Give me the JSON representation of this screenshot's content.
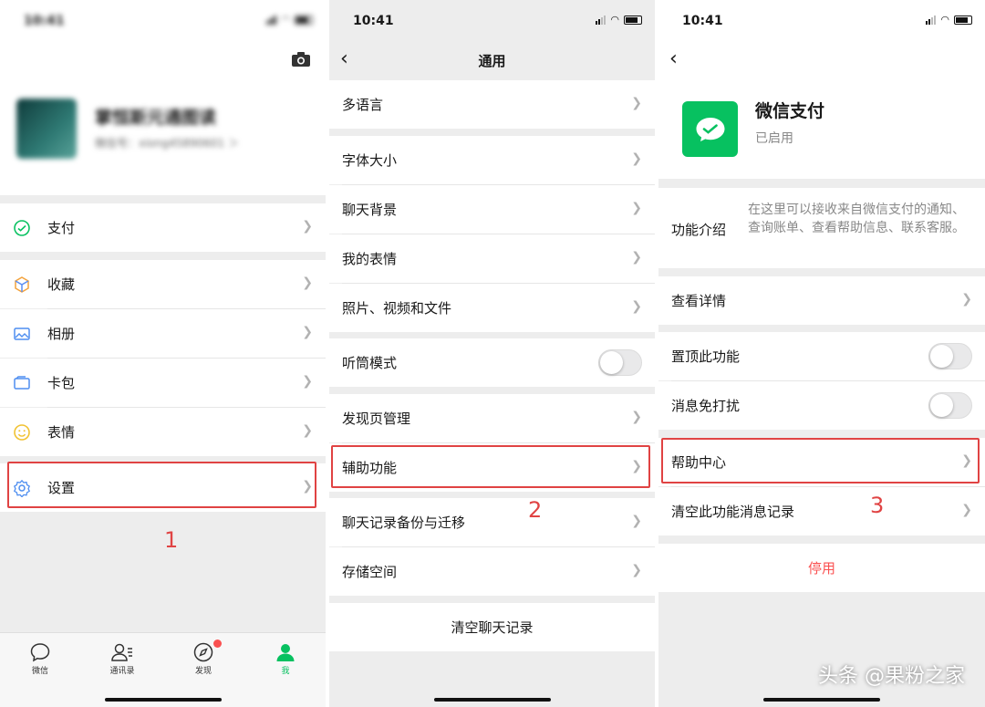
{
  "panel1": {
    "status": {
      "time": "10:41"
    },
    "profile": {
      "name": "掌恒斯元通图读",
      "id_line": "微信号：xiong45890601 ＞"
    },
    "items": [
      {
        "label": "支付",
        "icon": "wallet-icon"
      },
      {
        "label": "收藏",
        "icon": "cube-icon"
      },
      {
        "label": "相册",
        "icon": "photo-icon"
      },
      {
        "label": "卡包",
        "icon": "card-icon"
      },
      {
        "label": "表情",
        "icon": "smile-icon"
      },
      {
        "label": "设置",
        "icon": "gear-icon"
      }
    ],
    "step": "1",
    "tabs": [
      {
        "label": "微信",
        "icon": "chat-icon"
      },
      {
        "label": "通讯录",
        "icon": "contacts-icon"
      },
      {
        "label": "发现",
        "icon": "compass-icon"
      },
      {
        "label": "我",
        "icon": "person-icon"
      }
    ]
  },
  "panel2": {
    "status": {
      "time": "10:41"
    },
    "title": "通用",
    "items": [
      "多语言",
      "字体大小",
      "聊天背景",
      "我的表情",
      "照片、视频和文件",
      "听筒模式",
      "发现页管理",
      "辅助功能",
      "聊天记录备份与迁移",
      "存储空间"
    ],
    "toggles": {
      "earpiece_mode": false
    },
    "clear_chat": "清空聊天记录",
    "step": "2"
  },
  "panel3": {
    "status": {
      "time": "10:41"
    },
    "app": {
      "name": "微信支付",
      "status": "已启用"
    },
    "intro_label": "功能介绍",
    "intro_text": "在这里可以接收来自微信支付的通知、查询账单、查看帮助信息、联系客服。",
    "view_details": "查看详情",
    "pin_label": "置顶此功能",
    "mute_label": "消息免打扰",
    "toggles": {
      "pin": false,
      "mute": false
    },
    "help_center": "帮助中心",
    "clear_records": "清空此功能消息记录",
    "disable": "停用",
    "step": "3"
  },
  "watermark": "头条 @果粉之家",
  "colors": {
    "accent": "#07c160",
    "annotation": "#e04343",
    "danger": "#fa5151",
    "background": "#ededed"
  }
}
